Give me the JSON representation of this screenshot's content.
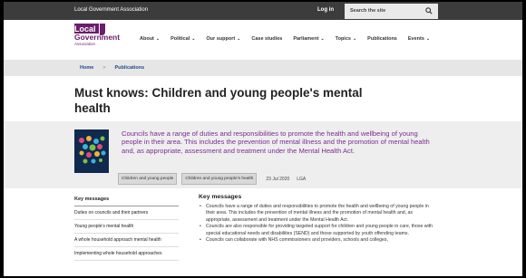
{
  "topbar": {
    "org_name": "Local Government Association",
    "login_label": "Log in",
    "search_placeholder": "Search the site"
  },
  "logo": {
    "line1": "Local",
    "line2": "Government",
    "line3": "Association"
  },
  "nav": [
    {
      "label": "About",
      "has_menu": true
    },
    {
      "label": "Political",
      "has_menu": true
    },
    {
      "label": "Our support",
      "has_menu": true
    },
    {
      "label": "Case studies",
      "has_menu": false
    },
    {
      "label": "Parliament",
      "has_menu": true
    },
    {
      "label": "Topics",
      "has_menu": true
    },
    {
      "label": "Publications",
      "has_menu": false
    },
    {
      "label": "Events",
      "has_menu": true
    }
  ],
  "breadcrumb": {
    "home": "Home",
    "separator": ">",
    "current": "Publications"
  },
  "page": {
    "title": "Must knows: Children and young people's mental health",
    "summary": "Councils have a range of duties and responsibilities to promote the health and wellbeing of young people in their area. This includes the prevention of mental illness and the promotion of mental health and, as appropriate, assessment and treatment under the Mental Health Act.",
    "tags": [
      "Children and young people",
      "Children and young people's health"
    ],
    "date": "23 Jul 2020",
    "publisher": "LGA"
  },
  "leftnav": {
    "title": "Key messages",
    "items": [
      "Duties on councils and their partners",
      "Young people's mental health",
      "A whole household approach mental health",
      "Implementing whole household approaches"
    ]
  },
  "main": {
    "title": "Key messages",
    "bullets": [
      "Councils have a range of duties and responsibilities to promote the health and wellbeing of young people in their area. This includes the prevention of mental illness and the promotion of mental health and, as appropriate, assessment and treatment under the Mental Health Act.",
      "Councils are also responsible for providing targeted support for children and young people in care, those with special educational needs and disabilities (SEND) and those supported by youth offending teams.",
      "Councils can collaborate with NHS commissioners and providers, schools and colleges,"
    ]
  },
  "colors": {
    "topbar": "#3c3c3c",
    "brand_purple": "#6a1e6b",
    "summary_text": "#7b2c93",
    "link_blue": "#214a8a"
  }
}
